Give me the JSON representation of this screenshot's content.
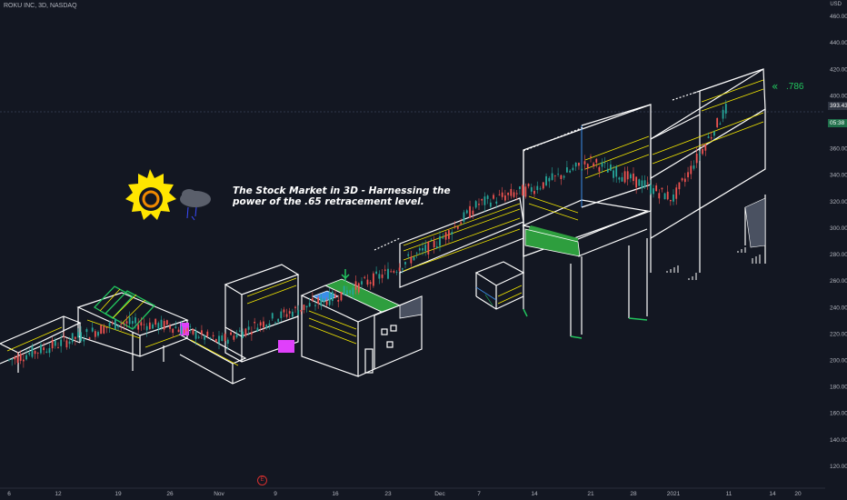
{
  "header": {
    "symbol_title": "ROKU INC, 3D, NASDAQ",
    "top_right": "USD"
  },
  "annotation": {
    "caption": "The Stock Market in 3D - Harnessing the power of the .65 retracement level.",
    "fib_label": ".786",
    "fib_arrow": "«"
  },
  "price_badge": {
    "price": "393.43",
    "time": "05:38"
  },
  "event_marker": {
    "label": "E"
  },
  "colors": {
    "background": "#131722",
    "axis_text": "#b2b5be",
    "outline": "#ffffff",
    "fib_yellow": "#f5e900",
    "fib_green": "#22c55e",
    "floor_green": "#2e9e3e",
    "water_blue": "#3b8ee8",
    "sun_yellow": "#ffe600",
    "sun_orange": "#f08a00",
    "magenta": "#e040fb",
    "up_candle": "#26a69a",
    "down_candle": "#ef5350"
  },
  "chart_data": {
    "type": "line",
    "title": "ROKU INC, 3D, NASDAQ",
    "y_axis": {
      "range": [
        110,
        470
      ],
      "ticks": [
        120,
        140,
        160,
        180,
        200,
        220,
        240,
        260,
        280,
        300,
        320,
        340,
        360,
        380,
        400,
        420,
        440,
        460
      ]
    },
    "x_axis": {
      "ticks": [
        "6",
        "12",
        "19",
        "26",
        "Nov",
        "9",
        "16",
        "23",
        "Dec",
        "7",
        "14",
        "21",
        "28",
        "2021",
        "11",
        "14",
        "20"
      ]
    },
    "series": [
      {
        "values": [
          {
            "x": "6",
            "y": 200
          },
          {
            "x": "12",
            "y": 212
          },
          {
            "x": "19",
            "y": 228
          },
          {
            "x": "26",
            "y": 226
          },
          {
            "x": "Nov",
            "y": 214
          },
          {
            "x": "9",
            "y": 232
          },
          {
            "x": "16",
            "y": 248
          },
          {
            "x": "23",
            "y": 266
          },
          {
            "x": "Dec",
            "y": 290
          },
          {
            "x": "7",
            "y": 318
          },
          {
            "x": "14",
            "y": 330
          },
          {
            "x": "21",
            "y": 350
          },
          {
            "x": "28",
            "y": 336
          },
          {
            "x": "2021",
            "y": 322
          },
          {
            "x": "11",
            "y": 393
          }
        ]
      }
    ]
  }
}
